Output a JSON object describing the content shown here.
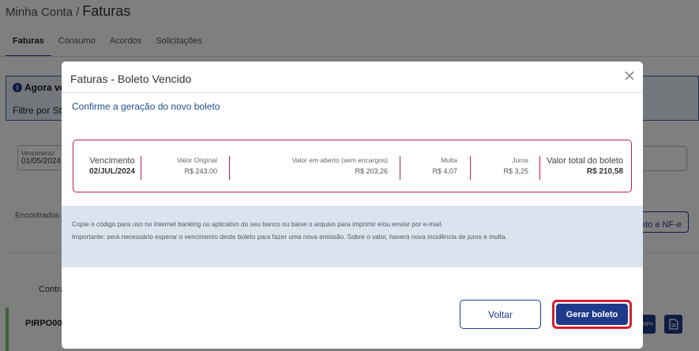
{
  "background": {
    "breadcrumb_parent": "Minha Conta",
    "breadcrumb_separator": "/",
    "breadcrumb_current": "Faturas",
    "tabs": [
      {
        "label": "Faturas"
      },
      {
        "label": "Consumo"
      },
      {
        "label": "Acordos"
      },
      {
        "label": "Solicitações"
      }
    ],
    "info_title": "Agora vo",
    "info_icon": "info-icon",
    "info_filter": "Filtre por Sta",
    "date_label": "Vencimento",
    "date_value": "01/05/2024",
    "found_text": "Encontrados",
    "nfe_button": "eto e NF-e",
    "col_header": "Contra",
    "row_contract": "PIRPO000",
    "row_btn_nfe": "NFe"
  },
  "modal": {
    "title": "Faturas - Boleto Vencido",
    "close_icon": "close-icon",
    "confirm_text": "Confirme a geração do novo boleto",
    "summary": {
      "vencimento_label": "Vencimento",
      "vencimento_value": "02/JUL/2024",
      "valor_original_label": "Valor Original",
      "valor_original_value": "R$ 243,00",
      "valor_aberto_label": "Valor em aberto (sem encargos)",
      "valor_aberto_value": "R$ 203,26",
      "multa_label": "Multa",
      "multa_value": "R$ 4,07",
      "juros_label": "Juros",
      "juros_value": "R$ 3,25",
      "total_label": "Valor total do boleto",
      "total_value": "R$ 210,58"
    },
    "notice_line1": "Copie o código para uso no Internet banking ou aplicativo do seu banco ou baixe o arquivo para imprimir e/ou enviar por e-mail.",
    "notice_line2": "Importante: será necessário esperar o vencimento deste boleto para fazer uma nova emissão. Sobre o valor, haverá nova incidência de juros e multa.",
    "btn_voltar": "Voltar",
    "btn_gerar": "Gerar boleto"
  },
  "colors": {
    "primary": "#1f3a8a",
    "accent_border": "#c2185b",
    "highlight": "#d21f2e",
    "notice_bg": "#dbe3ef"
  }
}
